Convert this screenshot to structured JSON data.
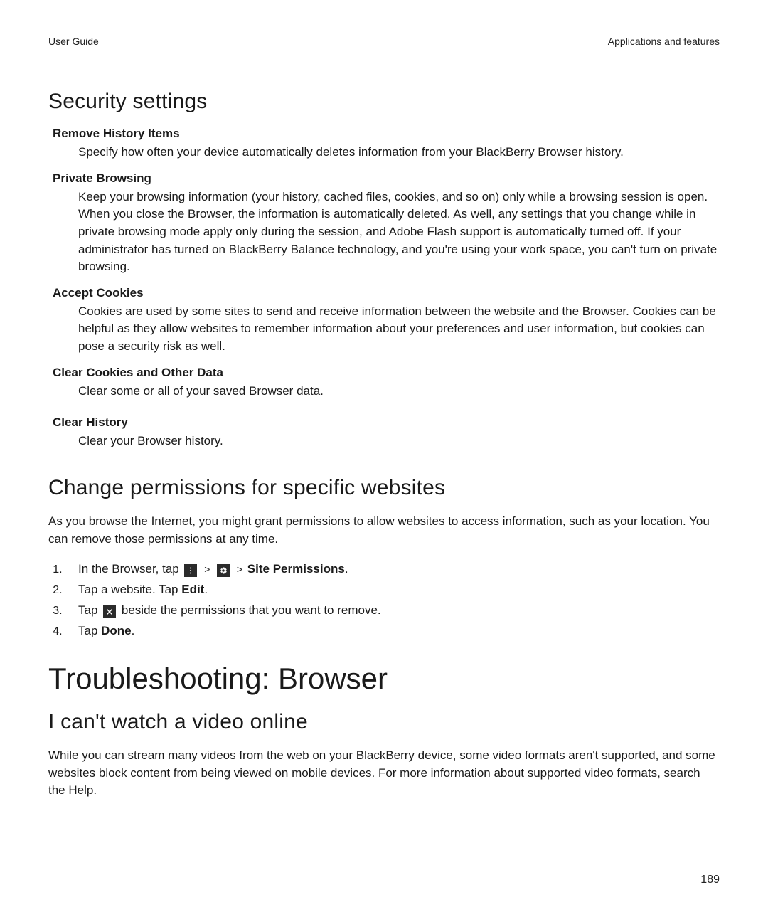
{
  "header": {
    "left": "User Guide",
    "right": "Applications and features"
  },
  "security": {
    "title": "Security settings",
    "items": [
      {
        "term": "Remove History Items",
        "desc": "Specify how often your device automatically deletes information from your BlackBerry Browser history."
      },
      {
        "term": "Private Browsing",
        "desc": "Keep your browsing information (your history, cached files, cookies, and so on) only while a browsing session is open. When you close the Browser, the information is automatically deleted. As well, any settings that you change while in private browsing mode apply only during the session, and Adobe Flash support is automatically turned off. If your administrator has turned on BlackBerry Balance technology, and you're using your work space, you can't turn on private browsing."
      },
      {
        "term": "Accept Cookies",
        "desc": "Cookies are used by some sites to send and receive information between the website and the Browser. Cookies can be helpful as they allow websites to remember information about your preferences and user information, but cookies can pose a security risk as well."
      },
      {
        "term": "Clear Cookies and Other Data",
        "desc": "Clear some or all of your saved Browser data."
      },
      {
        "term": "Clear History",
        "desc": "Clear your Browser history."
      }
    ]
  },
  "permissions": {
    "title": "Change permissions for specific websites",
    "intro": "As you browse the Internet, you might grant permissions to allow websites to access information, such as your location. You can remove those permissions at any time.",
    "step1_pre": "In the Browser, tap",
    "step1_post_label": "Site Permissions",
    "gt": ">",
    "step2_pre": "Tap a website. Tap ",
    "step2_label": "Edit",
    "step2_post": ".",
    "step3_pre": "Tap",
    "step3_post": "beside the permissions that you want to remove.",
    "step4_pre": "Tap ",
    "step4_label": "Done",
    "step4_post": "."
  },
  "troubleshoot": {
    "title": "Troubleshooting: Browser",
    "sub_title": "I can't watch a video online",
    "body": "While you can stream many videos from the web on your BlackBerry device, some video formats aren't supported, and some websites block content from being viewed on mobile devices. For more information about supported video formats, search the Help."
  },
  "page_number": "189"
}
